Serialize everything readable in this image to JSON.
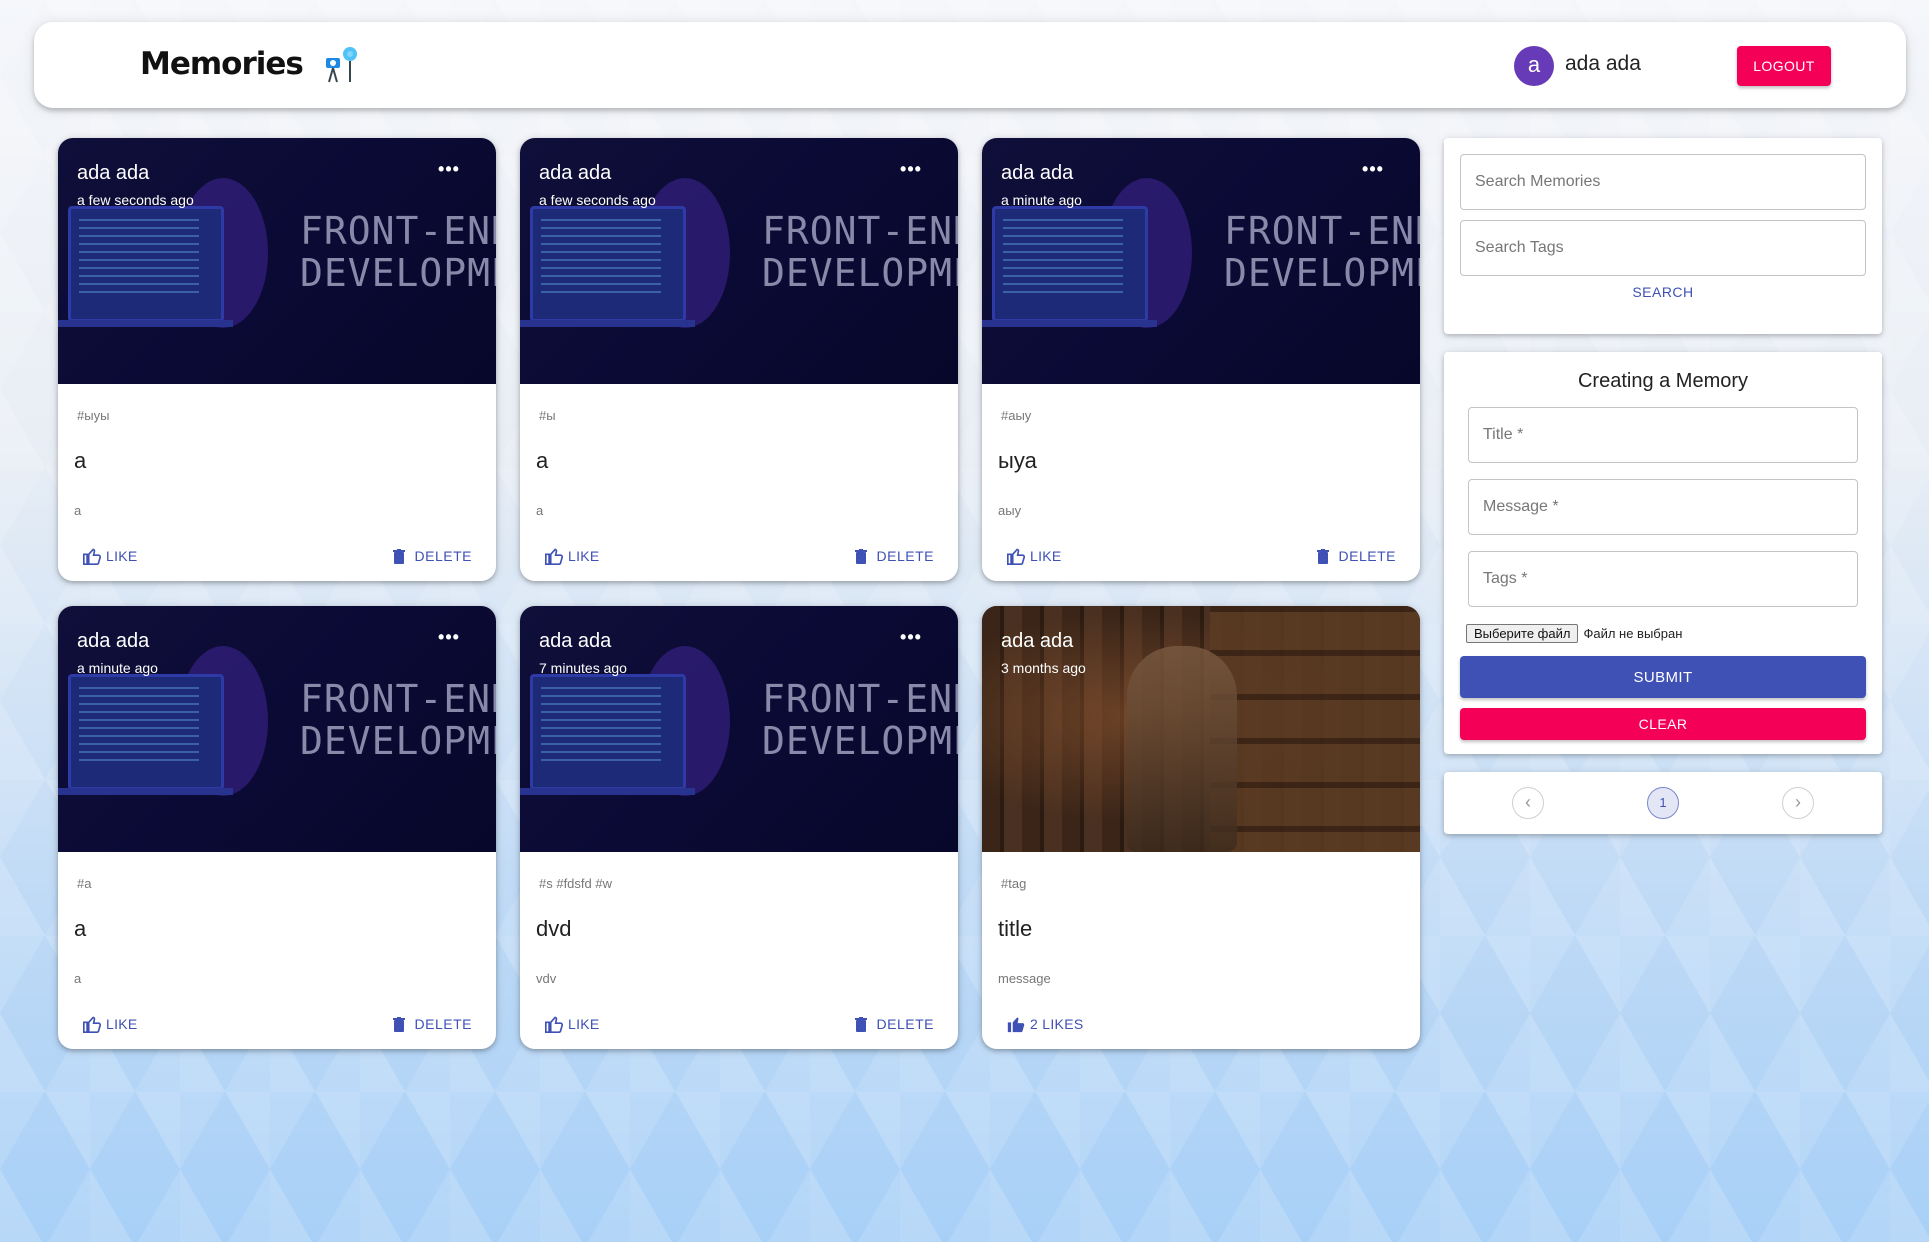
{
  "header": {
    "brand_title": "Memories",
    "user_initial": "a",
    "user_name": "ada ada",
    "logout_label": "LOGOUT"
  },
  "posts": [
    {
      "author": "ada ada",
      "time": "a few seconds ago",
      "image_text_1": "FRONT-END",
      "image_text_2": "DEVELOPMEN",
      "tags": "#ыуы",
      "title": "a",
      "message": "a",
      "like_label": "LIKE",
      "delete_label": "DELETE"
    },
    {
      "author": "ada ada",
      "time": "a few seconds ago",
      "image_text_1": "FRONT-END",
      "image_text_2": "DEVELOPMEN",
      "tags": "#ы",
      "title": "a",
      "message": "a",
      "like_label": "LIKE",
      "delete_label": "DELETE"
    },
    {
      "author": "ada ada",
      "time": "a minute ago",
      "image_text_1": "FRONT-END",
      "image_text_2": "DEVELOPMEN",
      "tags": "#аыу",
      "title": "ыуа",
      "message": "аыу",
      "like_label": "LIKE",
      "delete_label": "DELETE"
    },
    {
      "author": "ada ada",
      "time": "a minute ago",
      "image_text_1": "FRONT-END",
      "image_text_2": "DEVELOPMEN",
      "tags": "#a",
      "title": "a",
      "message": "a",
      "like_label": "LIKE",
      "delete_label": "DELETE"
    },
    {
      "author": "ada ada",
      "time": "7 minutes ago",
      "image_text_1": "FRONT-END",
      "image_text_2": "DEVELOPMEN",
      "tags": "#s #fdsfd #w",
      "title": "dvd",
      "message": "vdv",
      "like_label": "LIKE",
      "delete_label": "DELETE"
    },
    {
      "author": "ada ada",
      "time": "3 months ago",
      "tags": "#tag",
      "title": "title",
      "message": "message",
      "like_label": "2 LIKES"
    }
  ],
  "search": {
    "memories_placeholder": "Search Memories",
    "tags_placeholder": "Search Tags",
    "button_label": "SEARCH"
  },
  "form": {
    "title": "Creating a Memory",
    "title_placeholder": "Title *",
    "message_placeholder": "Message *",
    "tags_placeholder": "Tags *",
    "file_button_label": "Выберите файл",
    "file_status": "Файл не выбран",
    "submit_label": "SUBMIT",
    "clear_label": "CLEAR"
  },
  "pagination": {
    "prev_symbol": "‹",
    "current_page": "1",
    "next_symbol": "›"
  },
  "colors": {
    "primary": "#3f51b5",
    "secondary": "#f50057",
    "avatar": "#673ab7"
  }
}
